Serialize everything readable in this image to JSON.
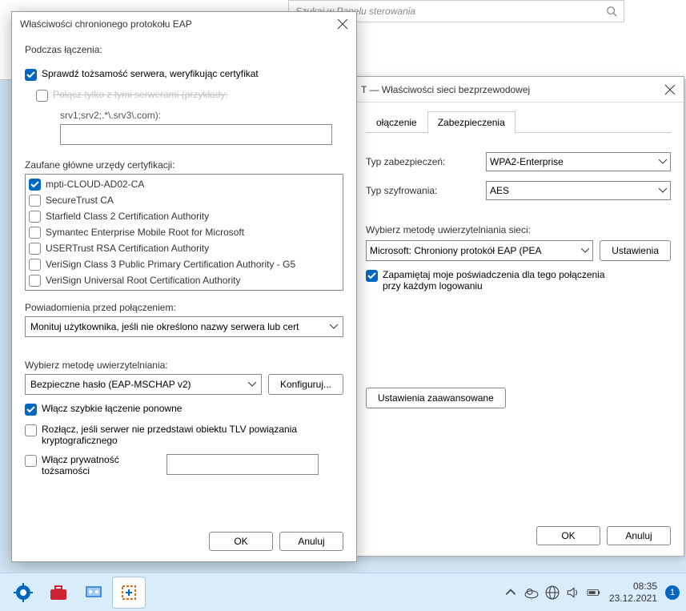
{
  "bg_search": {
    "placeholder": "Szukaj w Panelu sterowania"
  },
  "wireless": {
    "title_suffix": "T — Właściwości sieci bezprzewodowej",
    "tabs": {
      "connection_partial": "ołączenie",
      "security": "Zabezpieczenia"
    },
    "security_type_label": "Typ zabezpieczeń:",
    "security_type_value": "WPA2-Enterprise",
    "encryption_label": "Typ szyfrowania:",
    "encryption_value": "AES",
    "auth_method_label": "Wybierz metodę uwierzytelniania sieci:",
    "auth_method_value": "Microsoft: Chroniony protokół EAP (PEA",
    "settings_btn": "Ustawienia",
    "remember_creds": "Zapamiętaj moje poświadczenia dla tego połączenia przy każdym logowaniu",
    "advanced_btn": "Ustawienia zaawansowane",
    "ok": "OK",
    "cancel": "Anuluj"
  },
  "eap": {
    "title": "Właściwości chronionego protokołu EAP",
    "heading": "Podczas łączenia:",
    "verify_cert": "Sprawdź tożsamość serwera, weryfikując certyfikat",
    "connect_servers_partial": "Połącz tylko z tymi serwerami (przykłady:",
    "connect_servers_example": "srv1;srv2;.*\\.srv3\\.com):",
    "trusted_label": "Zaufane główne urzędy certyfikacji:",
    "trusted_items": [
      {
        "label": "mpti-CLOUD-AD02-CA",
        "checked": true
      },
      {
        "label": "SecureTrust CA",
        "checked": false
      },
      {
        "label": "Starfield Class 2 Certification Authority",
        "checked": false
      },
      {
        "label": "Symantec Enterprise Mobile Root for Microsoft",
        "checked": false
      },
      {
        "label": "USERTrust RSA Certification Authority",
        "checked": false
      },
      {
        "label": "VeriSign Class 3 Public Primary Certification Authority - G5",
        "checked": false
      },
      {
        "label": "VeriSign Universal Root Certification Authority",
        "checked": false
      }
    ],
    "notify_label": "Powiadomienia przed połączeniem:",
    "notify_value": "Monituj użytkownika, jeśli nie określono nazwy serwera lub cert",
    "auth_method_label": "Wybierz metodę uwierzytelniania:",
    "auth_method_value": "Bezpieczne hasło (EAP-MSCHAP v2)",
    "configure_btn": "Konfiguruj...",
    "fast_reconnect": "Włącz szybkie łączenie ponowne",
    "disconnect_tlv": "Rozłącz, jeśli serwer nie przedstawi obiektu TLV powiązania kryptograficznego",
    "identity_privacy": "Włącz prywatność tożsamości",
    "ok": "OK",
    "cancel": "Anuluj"
  },
  "taskbar": {
    "time": "08:35",
    "date": "23.12.2021",
    "notif_count": "1"
  }
}
